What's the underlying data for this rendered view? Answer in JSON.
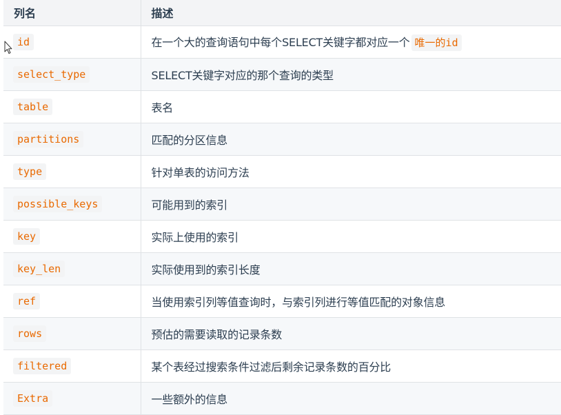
{
  "header": {
    "col_name": "列名",
    "col_desc": "描述"
  },
  "rows": [
    {
      "name": "id",
      "desc": "在一个大的查询语句中每个SELECT关键字都对应一个",
      "desc_code": "唯一的id"
    },
    {
      "name": "select_type",
      "desc": "SELECT关键字对应的那个查询的类型"
    },
    {
      "name": "table",
      "desc": "表名"
    },
    {
      "name": "partitions",
      "desc": "匹配的分区信息"
    },
    {
      "name": "type",
      "desc": "针对单表的访问方法"
    },
    {
      "name": "possible_keys",
      "desc": "可能用到的索引"
    },
    {
      "name": "key",
      "desc": "实际上使用的索引"
    },
    {
      "name": "key_len",
      "desc": "实际使用到的索引长度"
    },
    {
      "name": "ref",
      "desc": "当使用索引列等值查询时，与索引列进行等值匹配的对象信息"
    },
    {
      "name": "rows",
      "desc": "预估的需要读取的记录条数"
    },
    {
      "name": "filtered",
      "desc": "某个表经过搜索条件过滤后剩余记录条数的百分比"
    },
    {
      "name": "Extra",
      "desc": "一些额外的信息"
    }
  ],
  "colors": {
    "code_text": "#e96900",
    "code_bg": "#f3f4f5",
    "header_bg": "#f3f4f6",
    "alt_row_bg": "#f6f8fa",
    "border": "#dfe2e5",
    "text": "#2c3e50"
  },
  "icons": {
    "cursor": "mouse-pointer-icon"
  }
}
